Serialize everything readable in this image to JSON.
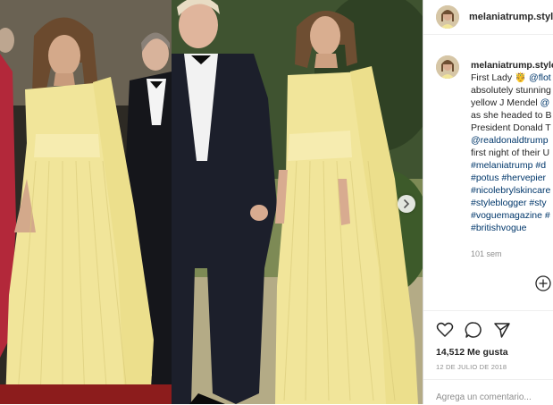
{
  "post": {
    "username": "melaniatrump.style",
    "caption_lines": [
      "First Lady",
      "absolutely stunning",
      "yellow J Mendel",
      "as she headed to B",
      "President Donald T",
      "@realdonaldtrump",
      "first night of their U",
      "#melaniatrump #d",
      "#potus #hervepier",
      "#nicolebrylskincare",
      "#styleblogger #sty",
      "#voguemagazine #",
      "#britishvogue"
    ],
    "caption_extra_mention": "@flot",
    "caption_extra_link": "@",
    "time_ago": "101 sem",
    "likes": "14,512 Me gusta",
    "date": "12 DE JULIO DE 2018",
    "comment_placeholder": "Agrega un comentario..."
  },
  "icons": {
    "avatar": "profile-avatar",
    "emoji": "crowned-face-emoji",
    "like": "heart-icon",
    "comment": "comment-bubble-icon",
    "share": "paper-plane-icon",
    "add": "plus-circle-icon",
    "next": "chevron-right-icon"
  },
  "colors": {
    "link": "#00376b",
    "text": "#262626",
    "muted": "#8e8e8e",
    "dress": "#f1e59a"
  }
}
